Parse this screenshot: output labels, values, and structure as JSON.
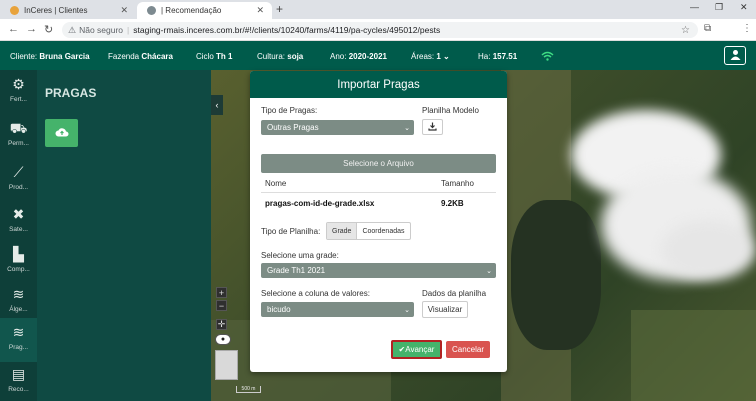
{
  "browser": {
    "tabs": [
      {
        "title": "InCeres | Clientes",
        "favicon_color": "#e8a33c"
      },
      {
        "title": "| Recomendação",
        "favicon_color": "#7d8a90"
      }
    ],
    "new_tab": "+",
    "security_label": "Não seguro",
    "url": "staging-rmais.inceres.com.br/#!/clients/10240/farms/4119/pa-cycles/495012/pests"
  },
  "header": {
    "cliente_label": "Cliente:",
    "cliente_value": "Bruna Garcia",
    "fazenda_label": "Fazenda",
    "fazenda_value": "Chácara",
    "ciclo_label": "Ciclo",
    "ciclo_value": "Th 1",
    "cultura_label": "Cultura:",
    "cultura_value": "soja",
    "ano_label": "Ano:",
    "ano_value": "2020-2021",
    "areas_label": "Áreas:",
    "areas_value": "1",
    "ha_label": "Ha:",
    "ha_value": "157.51"
  },
  "nav": [
    {
      "label": "Fert...",
      "icon": "fertilizer-icon"
    },
    {
      "label": "Perm...",
      "icon": "tractor-icon"
    },
    {
      "label": "Prod...",
      "icon": "chart-line-icon"
    },
    {
      "label": "Sate...",
      "icon": "satellite-icon"
    },
    {
      "label": "Comp...",
      "icon": "compare-icon"
    },
    {
      "label": "Álge...",
      "icon": "layers-icon"
    },
    {
      "label": "Prag...",
      "icon": "layers-icon"
    },
    {
      "label": "Reco...",
      "icon": "document-icon"
    }
  ],
  "panel": {
    "title": "PRAGAS"
  },
  "map": {
    "zoom_in": "+",
    "zoom_out": "−",
    "scale_label": "500 m"
  },
  "modal": {
    "title": "Importar Pragas",
    "tipo_pragas_label": "Tipo de Pragas:",
    "tipo_pragas_value": "Outras Pragas",
    "planilha_modelo_label": "Planilha Modelo",
    "selecione_arquivo": "Selecione o Arquivo",
    "table": {
      "headers": [
        "Nome",
        "Tamanho"
      ],
      "rows": [
        [
          "pragas-com-id-de-grade.xlsx",
          "9.2KB"
        ]
      ]
    },
    "tipo_planilha_label": "Tipo de Planilha:",
    "tipo_planilha_options": [
      "Grade",
      "Coordenadas"
    ],
    "grade_label": "Selecione uma grade:",
    "grade_value": "Grade Th1 2021",
    "coluna_label": "Selecione a coluna de valores:",
    "coluna_value": "bicudo",
    "dados_label": "Dados da planilha",
    "visualizar": "Visualizar",
    "avancar": "✔Avançar",
    "cancelar": "Cancelar"
  }
}
